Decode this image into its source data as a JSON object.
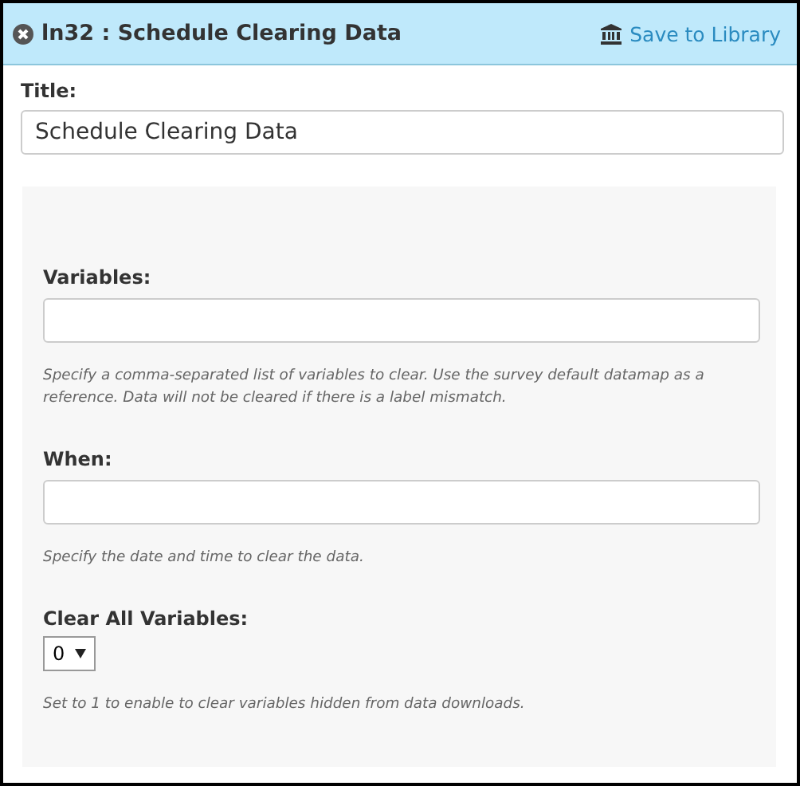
{
  "header": {
    "title": "ln32 : Schedule Clearing Data",
    "action": "Save to Library"
  },
  "title_field": {
    "label": "Title:",
    "value": "Schedule Clearing Data"
  },
  "fields": [
    {
      "kind": "text",
      "label": "Variables:",
      "help": "Specify a comma-separated list of variables to clear. Use the survey default datamap as a reference. Data will not be cleared if there is a label mismatch."
    },
    {
      "kind": "text",
      "label": "When:",
      "help": "Specify the date and time to clear the data."
    },
    {
      "kind": "select",
      "label": "Clear All Variables:",
      "value": "0",
      "help": "Set to 1 to enable to clear variables hidden from data downloads."
    }
  ]
}
